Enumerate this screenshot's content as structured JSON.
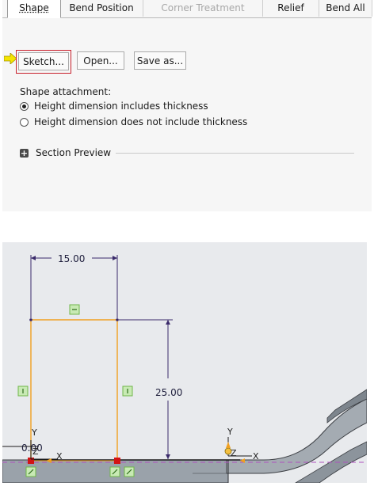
{
  "tabs": [
    {
      "label": "Shape",
      "state": "active"
    },
    {
      "label": "Bend Position",
      "state": "normal"
    },
    {
      "label": "Corner Treatment",
      "state": "disabled"
    },
    {
      "label": "Relief",
      "state": "normal"
    },
    {
      "label": "Bend All",
      "state": "normal"
    }
  ],
  "buttons": {
    "sketch": "Sketch...",
    "open": "Open...",
    "save_as": "Save as..."
  },
  "shape_attachment": {
    "heading": "Shape attachment:",
    "options": [
      {
        "label": "Height dimension includes thickness",
        "checked": true
      },
      {
        "label": "Height dimension does not include thickness",
        "checked": false
      }
    ]
  },
  "section_preview": {
    "label": "Section Preview",
    "expanded": false
  },
  "sketch": {
    "width_dim": "15.00",
    "height_dim": "25.00",
    "small_dim": "0.00",
    "axis_x": "X",
    "axis_y": "Y",
    "axis_z": "Z"
  },
  "colors": {
    "sketch_line": "#f0a020",
    "dimension": "#3a2a6a",
    "constraint": "#6fb64a",
    "highlight_frame": "#c8202c",
    "pointer_arrow": "#f4e400",
    "reference_line": "#b050c0"
  }
}
